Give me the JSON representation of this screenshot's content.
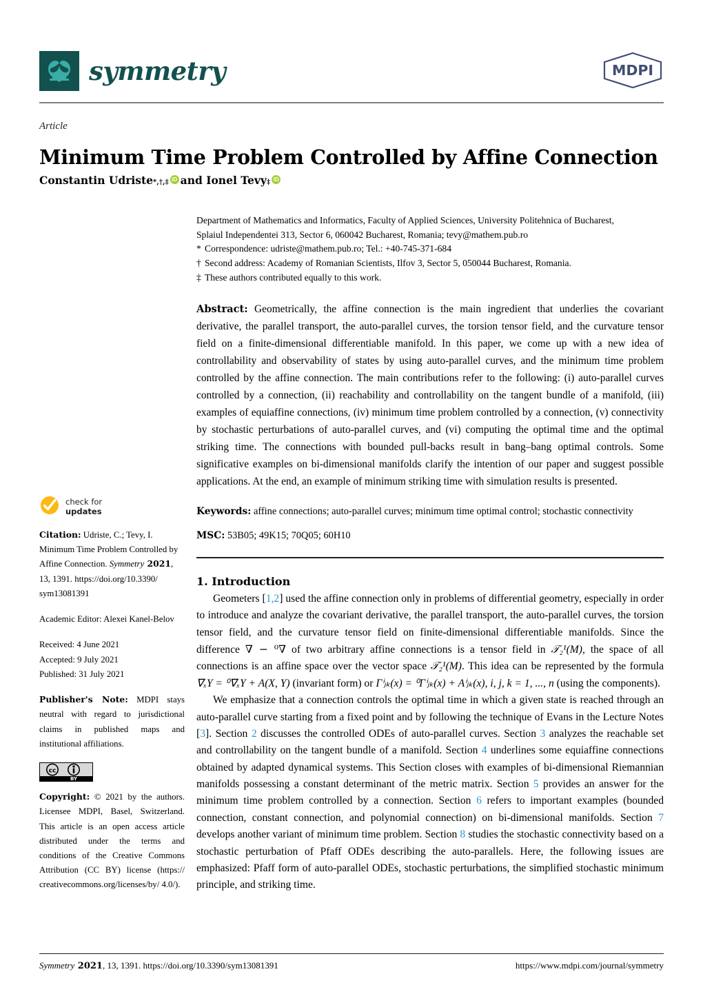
{
  "journal": {
    "name": "symmetry",
    "publisher_logo_text": "MDPI",
    "logo_colors": {
      "dark_teal": "#13514e",
      "light_teal": "#3aada6"
    },
    "mdpi_color": "#414e72"
  },
  "article": {
    "type": "Article",
    "title": "Minimum Time Problem Controlled by Affine Connection",
    "authors_prefix": "Constantin Udriste",
    "authors_prefix_marks": "*,†,‡",
    "authors_conjunction": " and Ionel Tevy ",
    "authors_suffix_marks": "‡",
    "orcid_icon": "orcid-id-icon"
  },
  "affiliation": {
    "line1": "Department of Mathematics and Informatics, Faculty of Applied Sciences, University Politehnica of Bucharest,",
    "line2": "Splaiul Independentei 313, Sector 6, 060042 Bucharest, Romania; tevy@mathem.pub.ro",
    "correspondence_marker": "*",
    "correspondence": "Correspondence: udriste@mathem.pub.ro; Tel.: +40-745-371-684",
    "second_address_marker": "†",
    "second_address": "Second address: Academy of Romanian Scientists, Ilfov 3, Sector 5, 050044 Bucharest, Romania.",
    "equal_contribution_marker": "‡",
    "equal_contribution": "These authors contributed equally to this work."
  },
  "abstract": {
    "label": "Abstract:",
    "text": " Geometrically, the affine connection is the main ingredient that underlies the covariant derivative, the parallel transport, the auto-parallel curves, the torsion tensor field, and the curvature tensor field on a finite-dimensional differentiable manifold. In this paper, we come up with a new idea of controllability and observability of states by using auto-parallel curves, and the minimum time problem controlled by the affine connection. The main contributions refer to the following: (i) auto-parallel curves controlled by a connection, (ii) reachability and controllability on the tangent bundle of a manifold, (iii) examples of equiaffine connections, (iv) minimum time problem controlled by a connection, (v) connectivity by stochastic perturbations of auto-parallel curves, and (vi) computing the optimal time and the optimal striking time.   The connections with bounded pull-backs result in bang–bang optimal controls. Some significative examples on bi-dimensional manifolds clarify the intention of our paper and suggest possible applications. At the end, an example of minimum striking time with simulation results is presented."
  },
  "keywords": {
    "label": "Keywords:",
    "text": " affine connections; auto-parallel curves; minimum time optimal control; stochastic connectivity"
  },
  "msc": {
    "label": "MSC:",
    "text": " 53B05; 49K15; 70Q05; 60H10"
  },
  "introduction": {
    "heading": "1. Introduction",
    "para1_a": "Geometers [",
    "ref1": "1",
    "ref_sep": ",",
    "ref2": "2",
    "para1_b": "] used the affine connection only in problems of differential geometry, especially in order to introduce and analyze the covariant derivative, the parallel transport, the auto-parallel curves, the torsion tensor field, and the curvature tensor field on finite-dimensional differentiable manifolds. Since the difference ",
    "formula1": "∇ − ⁰∇",
    "para1_c": " of two arbitrary affine connections is a tensor field in ",
    "formula2": "𝒯₂¹(M)",
    "para1_d": ", the space of all connections is an affine space over the vector space ",
    "formula3": "𝒯₂¹(M)",
    "para1_e": ". This idea can be represented by the formula ",
    "formula4": "∇ₓY = ⁰∇ₓY + A(X, Y)",
    "para1_f": " (invariant form) or ",
    "formula5": "Γⁱⱼₖ(x) = ⁰Γⁱⱼₖ(x) + Aⁱⱼₖ(x),  i, j, k = 1, ..., n",
    "para1_g": " (using the components).",
    "para2_a": "We emphasize that a connection controls the optimal time in which a given state is reached through an auto-parallel curve starting from a fixed point and by following the technique of Evans in the Lecture Notes [",
    "ref3": "3",
    "para2_b": "]. Section ",
    "ref_s2": "2",
    "para2_c": " discusses the controlled ODEs of auto-parallel curves. Section ",
    "ref_s3": "3",
    "para2_d": " analyzes the reachable set and controllability on the tangent bundle of a manifold. Section ",
    "ref_s4": "4",
    "para2_e": " underlines some equiaffine connections obtained by adapted dynamical systems. This Section closes with examples of bi-dimensional Riemannian manifolds possessing a constant determinant of the metric matrix. Section ",
    "ref_s5": "5",
    "para2_f": " provides an answer for the minimum time problem controlled by a connection. Section ",
    "ref_s6": "6",
    "para2_g": " refers to important examples (bounded connection, constant connection, and polynomial connection) on bi-dimensional manifolds. Section ",
    "ref_s7": "7",
    "para2_h": " develops another variant of minimum time problem. Section ",
    "ref_s8": "8",
    "para2_i": " studies the stochastic connectivity based on a stochastic perturbation of Pfaff ODEs describing the auto-parallels.  Here, the following issues are emphasized: Pfaff form of auto-parallel ODEs, stochastic perturbations, the simplified stochastic minimum principle, and striking time."
  },
  "sidebar": {
    "check_for_updates": {
      "line1": "check for",
      "line2": "updates",
      "icon": "check-mark-icon"
    },
    "citation": {
      "label": "Citation:",
      "text_a": "  Udriste, C.; Tevy, I. Minimum Time Problem Controlled by Affine Connection. ",
      "journal_italic": "Symmetry",
      "year_bold": " 2021",
      "text_b": ", 13, 1391.  https://doi.org/10.3390/ sym13081391"
    },
    "academic_editor": "Academic Editor: Alexei Kanel-Belov",
    "received": "Received: 4 June 2021",
    "accepted": "Accepted: 9 July 2021",
    "published": "Published: 31 July 2021",
    "publisher_note": {
      "label": "Publisher's Note:",
      "text": " MDPI stays neutral with regard to jurisdictional claims in published maps and institutional affiliations."
    },
    "cc_badge": {
      "cc_icon": "creative-commons-icon",
      "by_icon": "attribution-person-icon",
      "by_label": "BY"
    },
    "copyright": {
      "label": "Copyright:",
      "text": " © 2021 by the authors. Licensee MDPI, Basel, Switzerland. This article is an open access article distributed under the terms and conditions of the Creative Commons Attribution (CC BY) license (https:// creativecommons.org/licenses/by/ 4.0/)."
    }
  },
  "footer": {
    "left_journal_italic": "Symmetry",
    "left_year_bold": " 2021",
    "left_rest": ", 13, 1391. https://doi.org/10.3390/sym13081391",
    "right": "https://www.mdpi.com/journal/symmetry"
  }
}
